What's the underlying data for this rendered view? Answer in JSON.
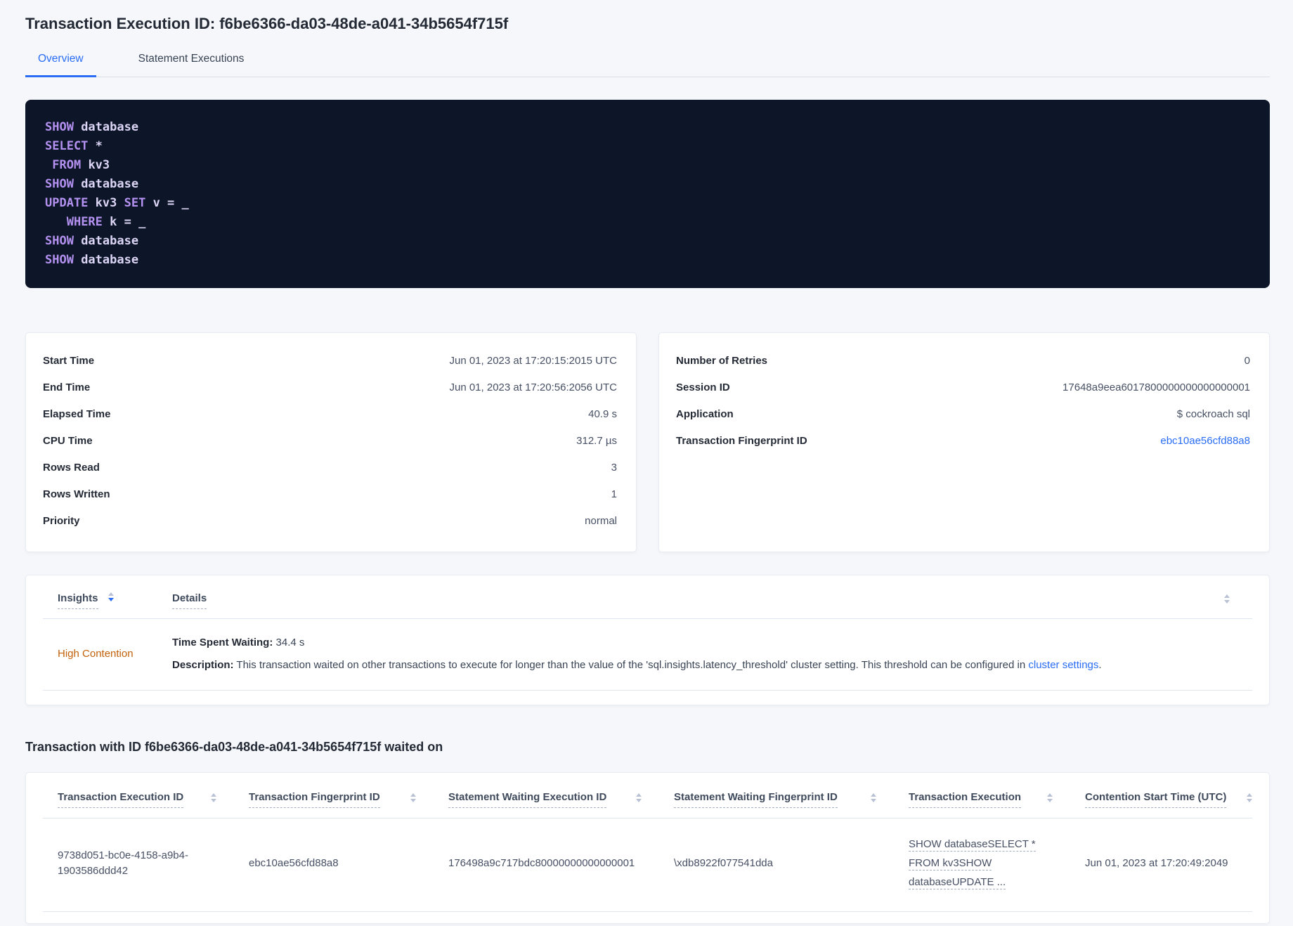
{
  "header": {
    "title": "Transaction Execution ID: f6be6366-da03-48de-a041-34b5654f715f"
  },
  "tabs": [
    {
      "label": "Overview"
    },
    {
      "label": "Statement Executions"
    }
  ],
  "code": {
    "lines": [
      {
        "s": [
          {
            "t": "SHOW"
          },
          {
            "t": " database"
          }
        ]
      },
      {
        "s": [
          {
            "t": "SELECT"
          },
          {
            "t": " *"
          }
        ]
      },
      {
        "s": [
          {
            "t": " "
          },
          {
            "t": "FROM"
          },
          {
            "t": " kv3"
          }
        ]
      },
      {
        "s": [
          {
            "t": "SHOW"
          },
          {
            "t": " database"
          }
        ]
      },
      {
        "s": [
          {
            "t": "UPDATE"
          },
          {
            "t": " kv3 "
          },
          {
            "t": "SET"
          },
          {
            "t": " v = _"
          }
        ]
      },
      {
        "s": [
          {
            "t": "   "
          },
          {
            "t": "WHERE"
          },
          {
            "t": " k = _"
          }
        ]
      },
      {
        "s": [
          {
            "t": "SHOW"
          },
          {
            "t": " database"
          }
        ]
      },
      {
        "s": [
          {
            "t": "SHOW"
          },
          {
            "t": " database"
          }
        ]
      }
    ]
  },
  "stats_left": {
    "rows": [
      {
        "label": "Start Time",
        "value": "Jun 01, 2023 at 17:20:15:2015 UTC"
      },
      {
        "label": "End Time",
        "value": "Jun 01, 2023 at 17:20:56:2056 UTC"
      },
      {
        "label": "Elapsed Time",
        "value": "40.9 s"
      },
      {
        "label": "CPU Time",
        "value": "312.7 µs"
      },
      {
        "label": "Rows Read",
        "value": "3"
      },
      {
        "label": "Rows Written",
        "value": "1"
      },
      {
        "label": "Priority",
        "value": "normal"
      }
    ]
  },
  "stats_right": {
    "rows": [
      {
        "label": "Number of Retries",
        "value": "0"
      },
      {
        "label": "Session ID",
        "value": "17648a9eea6017800000000000000001"
      },
      {
        "label": "Application",
        "value": "$ cockroach sql"
      },
      {
        "label": "Transaction Fingerprint ID",
        "value": "ebc10ae56cfd88a8"
      }
    ]
  },
  "insights": {
    "col1": "Insights",
    "col2": "Details",
    "row": {
      "insight": "High Contention",
      "waiting_label": "Time Spent Waiting:",
      "waiting_value": "34.4 s",
      "desc_label": "Description:",
      "desc_text": "This transaction waited on other transactions to execute for longer than the value of the 'sql.insights.latency_threshold' cluster setting. This threshold can be configured in ",
      "desc_link": "cluster settings",
      "desc_suffix": "."
    }
  },
  "waited_on": {
    "heading": "Transaction with ID f6be6366-da03-48de-a041-34b5654f715f waited on",
    "columns": [
      "Transaction Execution ID",
      "Transaction Fingerprint ID",
      "Statement Waiting Execution ID",
      "Statement Waiting Fingerprint ID",
      "Transaction Execution",
      "Contention Start Time (UTC)"
    ],
    "row": {
      "transaction_execution_id": "9738d051-bc0e-4158-a9b4-1903586ddd42",
      "transaction_fingerprint_id": "ebc10ae56cfd88a8",
      "statement_waiting_execution_id": "176498a9c717bdc80000000000000001",
      "statement_waiting_fingerprint_id": "\\xdb8922f077541dda",
      "transaction_execution_lines": [
        "SHOW databaseSELECT *",
        "FROM kv3SHOW",
        "databaseUPDATE ..."
      ],
      "contention_start_time": "Jun 01, 2023 at 17:20:49:2049"
    }
  },
  "colors": {
    "accent_blue": "#2a6df4",
    "insight_orange": "#c2610b",
    "code_background": "#0c1628",
    "code_keyword": "#b592f2",
    "code_text": "#ddd5f6"
  }
}
